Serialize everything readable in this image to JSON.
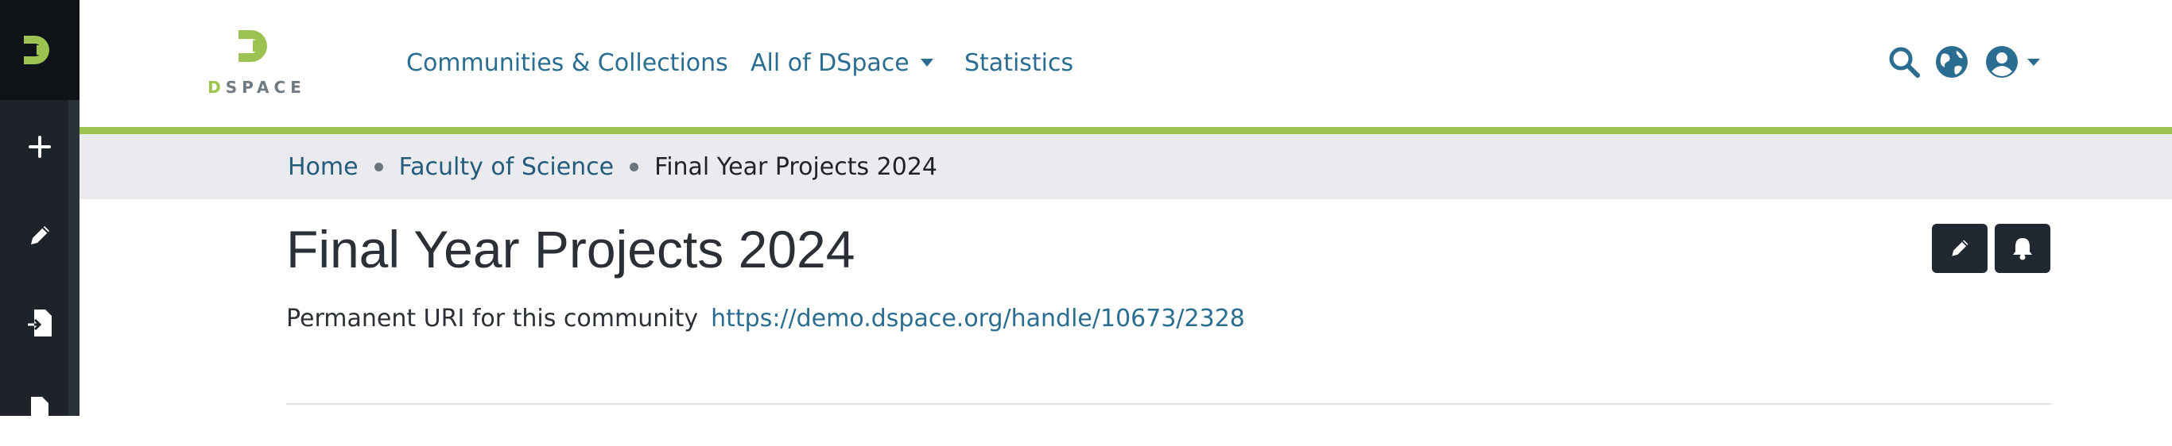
{
  "sidebar": {
    "items": [
      {
        "name": "new",
        "icon": "plus-icon"
      },
      {
        "name": "edit",
        "icon": "pencil-icon"
      },
      {
        "name": "import",
        "icon": "file-import-icon"
      },
      {
        "name": "export",
        "icon": "file-export-icon"
      }
    ]
  },
  "header": {
    "brand_word_first": "D",
    "brand_word_rest": "SPACE",
    "nav": {
      "communities": "Communities & Collections",
      "all_of_dspace": "All of DSpace",
      "statistics": "Statistics"
    },
    "icons": [
      "search-icon",
      "language-globe-icon",
      "user-account-icon"
    ]
  },
  "breadcrumb": {
    "home": "Home",
    "faculty": "Faculty of Science",
    "current": "Final Year Projects 2024"
  },
  "main": {
    "title": "Final Year Projects 2024",
    "uri_label": "Permanent URI for this community",
    "uri_value": "https://demo.dspace.org/handle/10673/2328"
  },
  "colors": {
    "brand_green": "#9cc252",
    "link": "#2a6d91",
    "sidebar": "#1e2229",
    "breadcrumb_bg": "#eaebee"
  }
}
